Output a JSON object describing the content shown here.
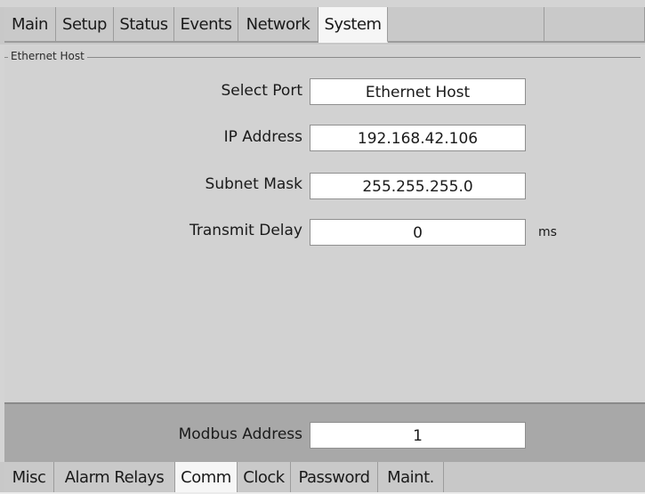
{
  "top_tabs": [
    "Main",
    "Setup",
    "Status",
    "Events",
    "Network",
    "System"
  ],
  "group": {
    "title": "Ethernet Host"
  },
  "fields": {
    "select_port": {
      "label": "Select Port",
      "value": "Ethernet Host"
    },
    "ip_address": {
      "label": "IP Address",
      "value": "192.168.42.106"
    },
    "subnet_mask": {
      "label": "Subnet Mask",
      "value": "255.255.255.0"
    },
    "transmit_delay": {
      "label": "Transmit Delay",
      "value": "0",
      "unit": "ms"
    },
    "modbus_address": {
      "label": "Modbus Address",
      "value": "1"
    }
  },
  "bottom_tabs": [
    "Misc",
    "Alarm Relays",
    "Comm",
    "Clock",
    "Password",
    "Maint."
  ],
  "colors": {
    "active_tab": "#f6f6f6",
    "inactive_tab": "#c9c9c9",
    "panel": "#d2d2d2",
    "bottom_bar": "#a8a8a8"
  }
}
